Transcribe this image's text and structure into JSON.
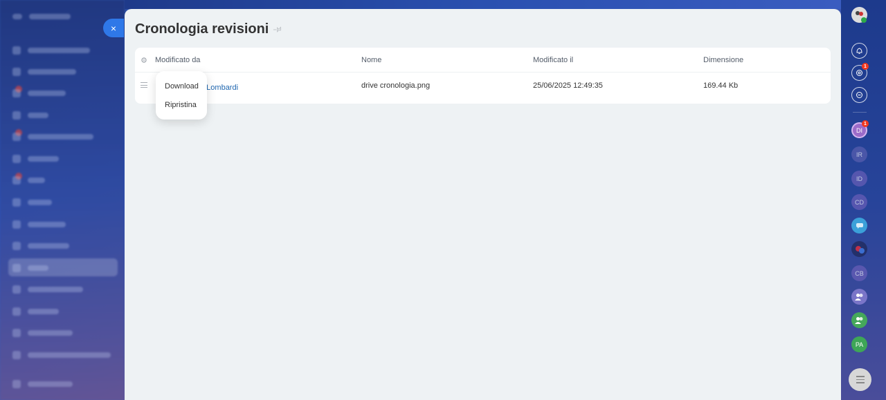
{
  "slider": {
    "title": "Cronologia revisioni",
    "close_icon": "×"
  },
  "grid": {
    "columns": [
      "Modificato da",
      "Nome",
      "Modificato il",
      "Dimensione"
    ],
    "rows": [
      {
        "modified_by": "a Lombardi",
        "name": "drive cronologia.png",
        "modified_on": "25/06/2025 12:49:35",
        "size": "169.44 Kb"
      }
    ]
  },
  "context_menu": {
    "items": [
      "Download",
      "Ripristina"
    ]
  },
  "right_bar": {
    "notification_badge": "1",
    "avatar_badge": "1",
    "avatars": [
      "DI",
      "IR",
      "ID",
      "CD",
      "CB",
      "PA"
    ]
  },
  "colors": {
    "accent": "#2f78e8",
    "link": "#2067b0",
    "badge": "#f0371d"
  }
}
